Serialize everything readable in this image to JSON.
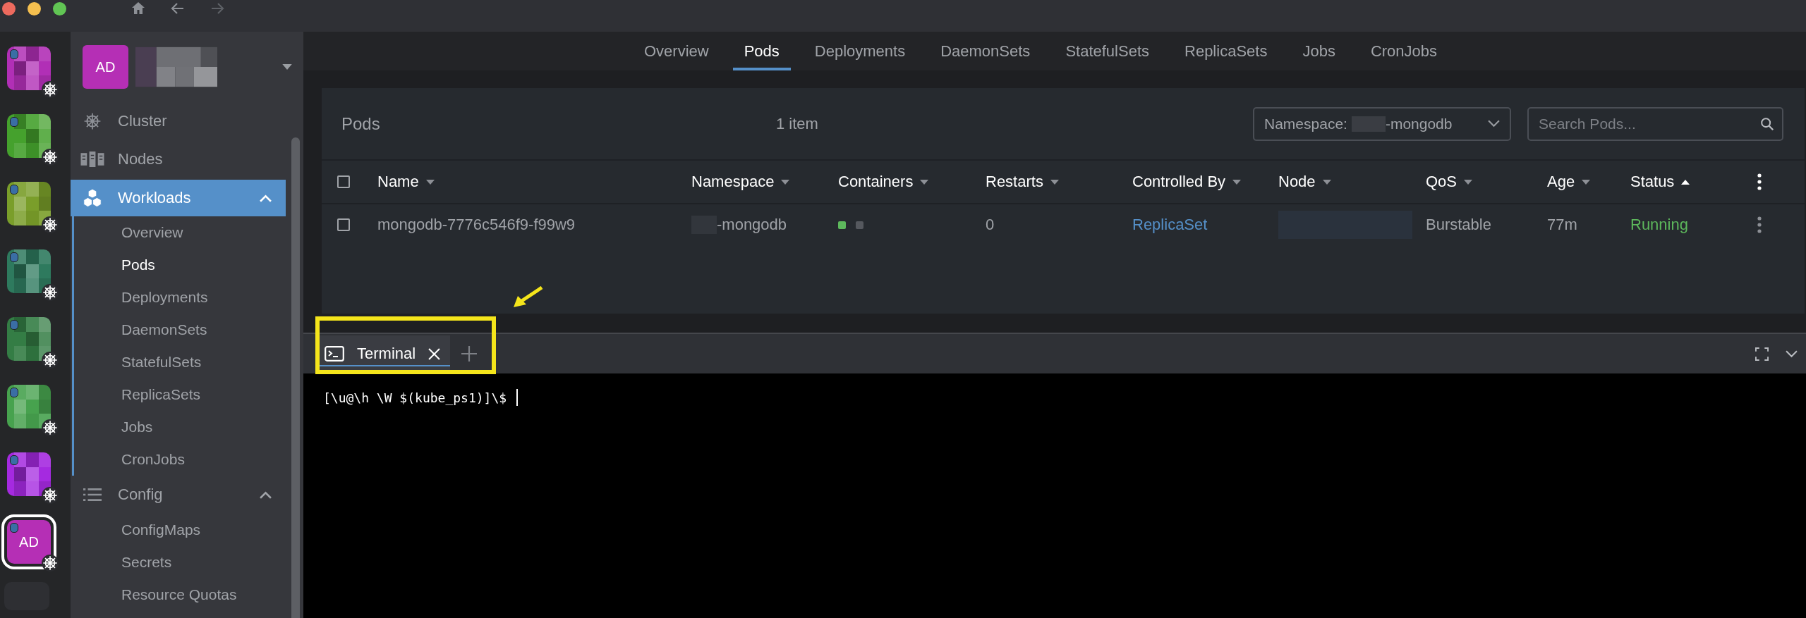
{
  "clusters": [
    {
      "color": "#b12fb6",
      "selected": false
    },
    {
      "color": "#45a12d",
      "selected": false
    },
    {
      "color": "#7a9e2a",
      "selected": false
    },
    {
      "color": "#2e7a5e",
      "selected": false
    },
    {
      "color": "#347d45",
      "selected": false
    },
    {
      "color": "#47a24e",
      "selected": false
    },
    {
      "color": "#a52ae0",
      "selected": false
    },
    {
      "color": "#b52fb5",
      "selected": true,
      "label": "AD"
    }
  ],
  "sidebar": {
    "account": {
      "initials": "AD"
    },
    "items": [
      {
        "kind": "cluster",
        "label": "Cluster",
        "selected": false
      },
      {
        "kind": "nodes",
        "label": "Nodes",
        "selected": false
      },
      {
        "kind": "workloads",
        "label": "Workloads",
        "selected": true,
        "expanded": true,
        "children": [
          {
            "label": "Overview",
            "selected": false
          },
          {
            "label": "Pods",
            "selected": true
          },
          {
            "label": "Deployments",
            "selected": false
          },
          {
            "label": "DaemonSets",
            "selected": false
          },
          {
            "label": "StatefulSets",
            "selected": false
          },
          {
            "label": "ReplicaSets",
            "selected": false
          },
          {
            "label": "Jobs",
            "selected": false
          },
          {
            "label": "CronJobs",
            "selected": false
          }
        ]
      },
      {
        "kind": "config",
        "label": "Config",
        "selected": false,
        "expanded": true,
        "children": [
          {
            "label": "ConfigMaps",
            "selected": false
          },
          {
            "label": "Secrets",
            "selected": false
          },
          {
            "label": "Resource Quotas",
            "selected": false
          }
        ]
      }
    ]
  },
  "tabs": [
    {
      "label": "Overview",
      "selected": false
    },
    {
      "label": "Pods",
      "selected": true
    },
    {
      "label": "Deployments",
      "selected": false
    },
    {
      "label": "DaemonSets",
      "selected": false
    },
    {
      "label": "StatefulSets",
      "selected": false
    },
    {
      "label": "ReplicaSets",
      "selected": false
    },
    {
      "label": "Jobs",
      "selected": false
    },
    {
      "label": "CronJobs",
      "selected": false
    }
  ],
  "pods": {
    "title": "Pods",
    "count": "1 item",
    "namespace_filter": {
      "label": "Namespace:",
      "value": "-mongodb"
    },
    "search": {
      "placeholder": "Search Pods..."
    },
    "all_checked": false,
    "columns": [
      {
        "label": "Name",
        "sorted": false
      },
      {
        "label": "Namespace",
        "sorted": false
      },
      {
        "label": "Containers",
        "sorted": false
      },
      {
        "label": "Restarts",
        "sorted": false
      },
      {
        "label": "Controlled By",
        "sorted": false
      },
      {
        "label": "Node",
        "sorted": false
      },
      {
        "label": "QoS",
        "sorted": false
      },
      {
        "label": "Age",
        "sorted": false
      },
      {
        "label": "Status",
        "sorted": true
      }
    ],
    "rows": [
      {
        "checked": false,
        "name": "mongodb-7776c546f9-f99w9",
        "namespace": "-mongodb",
        "containers": [
          {
            "color": "#5db85c"
          },
          {
            "color": "#55585e"
          }
        ],
        "restarts": "0",
        "controlled_by": "ReplicaSet",
        "qos": "Burstable",
        "age": "77m",
        "status": "Running"
      }
    ]
  },
  "dock": {
    "tabs": [
      {
        "label": "Terminal",
        "selected": true
      }
    ],
    "terminal": {
      "prompt": "[\\u@\\h \\W $(kube_ps1)]\\$"
    }
  }
}
